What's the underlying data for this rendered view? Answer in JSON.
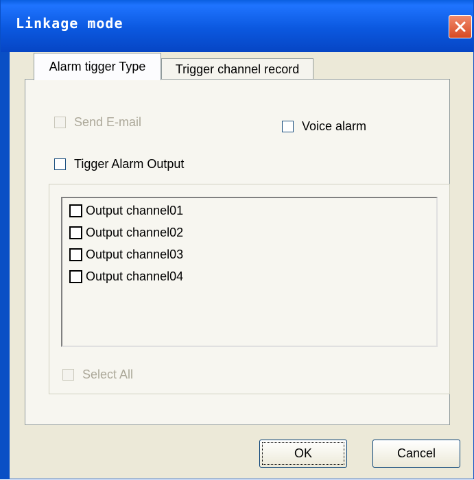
{
  "window": {
    "title": "Linkage mode"
  },
  "tabs": [
    {
      "label": "Alarm tigger Type",
      "active": true
    },
    {
      "label": "Trigger channel record",
      "active": false
    }
  ],
  "options": {
    "send_email": {
      "label": "Send E-mail",
      "checked": false,
      "enabled": false
    },
    "voice_alarm": {
      "label": "Voice alarm",
      "checked": false,
      "enabled": true
    },
    "trigger_alarm_output": {
      "label": "Tigger Alarm Output",
      "checked": false,
      "enabled": true
    }
  },
  "output_channels": [
    {
      "label": "Output channel01",
      "checked": false
    },
    {
      "label": "Output channel02",
      "checked": false
    },
    {
      "label": "Output channel03",
      "checked": false
    },
    {
      "label": "Output channel04",
      "checked": false
    }
  ],
  "select_all": {
    "label": "Select All",
    "checked": false,
    "enabled": false
  },
  "buttons": {
    "ok": "OK",
    "cancel": "Cancel"
  },
  "icons": {
    "close": "close-icon"
  }
}
